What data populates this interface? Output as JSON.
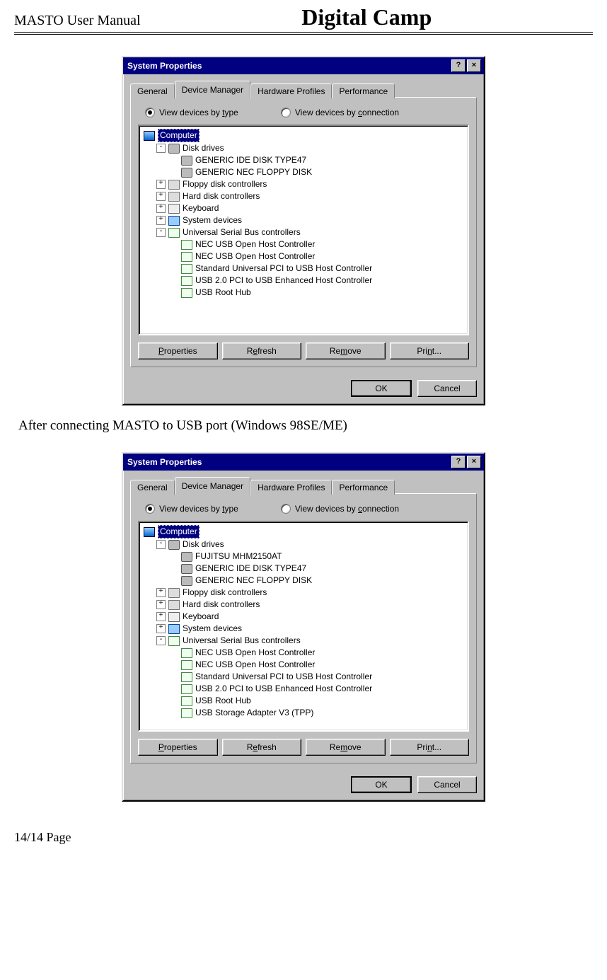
{
  "doc": {
    "header_left": "MASTO User Manual",
    "header_center": "Digital Camp",
    "caption": "After connecting MASTO to USB port (Windows 98SE/ME)",
    "footer": "14/14 Page"
  },
  "dialog": {
    "title": "System Properties",
    "help_btn": "?",
    "close_btn": "×",
    "tabs": {
      "general": "General",
      "device_manager": "Device Manager",
      "hardware_profiles": "Hardware Profiles",
      "performance": "Performance"
    },
    "radios": {
      "by_type_pre": "View devices by ",
      "by_type_u": "t",
      "by_type_post": "ype",
      "by_conn_pre": "View devices by ",
      "by_conn_u": "c",
      "by_conn_post": "onnection"
    },
    "buttons": {
      "properties": "Properties",
      "refresh": "Refresh",
      "remove": "Remove",
      "print": "Print...",
      "ok": "OK",
      "cancel": "Cancel"
    }
  },
  "tree1": {
    "root": "Computer",
    "disk_drives": "Disk drives",
    "d1": "GENERIC IDE  DISK TYPE47",
    "d2": "GENERIC NEC  FLOPPY DISK",
    "floppy": "Floppy disk controllers",
    "hard": "Hard disk controllers",
    "keyboard": "Keyboard",
    "system": "System devices",
    "usb": "Universal Serial Bus controllers",
    "u1": "NEC USB Open Host Controller",
    "u2": "NEC USB Open Host Controller",
    "u3": "Standard Universal PCI to USB Host Controller",
    "u4": "USB 2.0 PCI to USB Enhanced Host Controller",
    "u5": "USB Root Hub"
  },
  "tree2": {
    "root": "Computer",
    "disk_drives": "Disk drives",
    "d0": "FUJITSU MHM2150AT",
    "d1": "GENERIC IDE  DISK TYPE47",
    "d2": "GENERIC NEC  FLOPPY DISK",
    "floppy": "Floppy disk controllers",
    "hard": "Hard disk controllers",
    "keyboard": "Keyboard",
    "system": "System devices",
    "usb": "Universal Serial Bus controllers",
    "u1": "NEC USB Open Host Controller",
    "u2": "NEC USB Open Host Controller",
    "u3": "Standard Universal PCI to USB Host Controller",
    "u4": "USB 2.0 PCI to USB Enhanced Host Controller",
    "u5": "USB Root Hub",
    "u6": "USB Storage Adapter V3 (TPP)"
  }
}
